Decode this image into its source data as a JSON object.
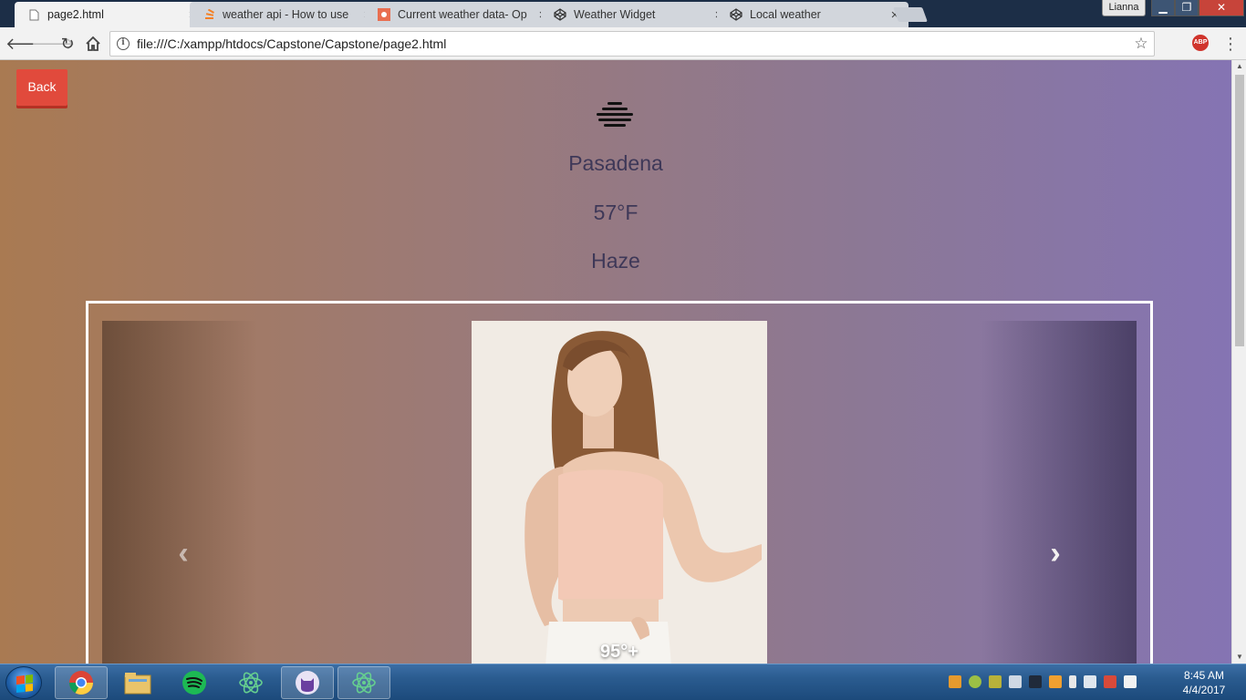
{
  "browser": {
    "tabs": [
      {
        "title": "page2.html",
        "favicon": "document-icon",
        "active": true
      },
      {
        "title": "weather api - How to use",
        "favicon": "stackoverflow-icon",
        "active": false
      },
      {
        "title": "Current weather data- Op",
        "favicon": "openweather-icon",
        "active": false
      },
      {
        "title": "Weather Widget",
        "favicon": "codepen-icon",
        "active": false
      },
      {
        "title": "Local weather",
        "favicon": "codepen-icon",
        "active": false
      }
    ],
    "close_glyph": "×",
    "profile_name": "Lianna",
    "address": "file:///C:/xampp/htdocs/Capstone/Capstone/page2.html",
    "extension_label": "ABP"
  },
  "page": {
    "back_label": "Back",
    "weather_icon": "haze-icon",
    "city": "Pasadena",
    "temperature": "57°F",
    "condition": "Haze",
    "carousel": {
      "caption": "95°+",
      "prev_icon": "chevron-left-icon",
      "next_icon": "chevron-right-icon"
    }
  },
  "taskbar": {
    "apps": [
      "chrome-icon",
      "file-explorer-icon",
      "spotify-icon",
      "atom-icon",
      "github-desktop-icon",
      "atom-icon"
    ],
    "time": "8:45 AM",
    "date": "4/4/2017"
  },
  "colors": {
    "gradient_start": "#a97a52",
    "gradient_end": "#8574b3",
    "back_button": "#e14a3c",
    "text": "#3e3858"
  }
}
